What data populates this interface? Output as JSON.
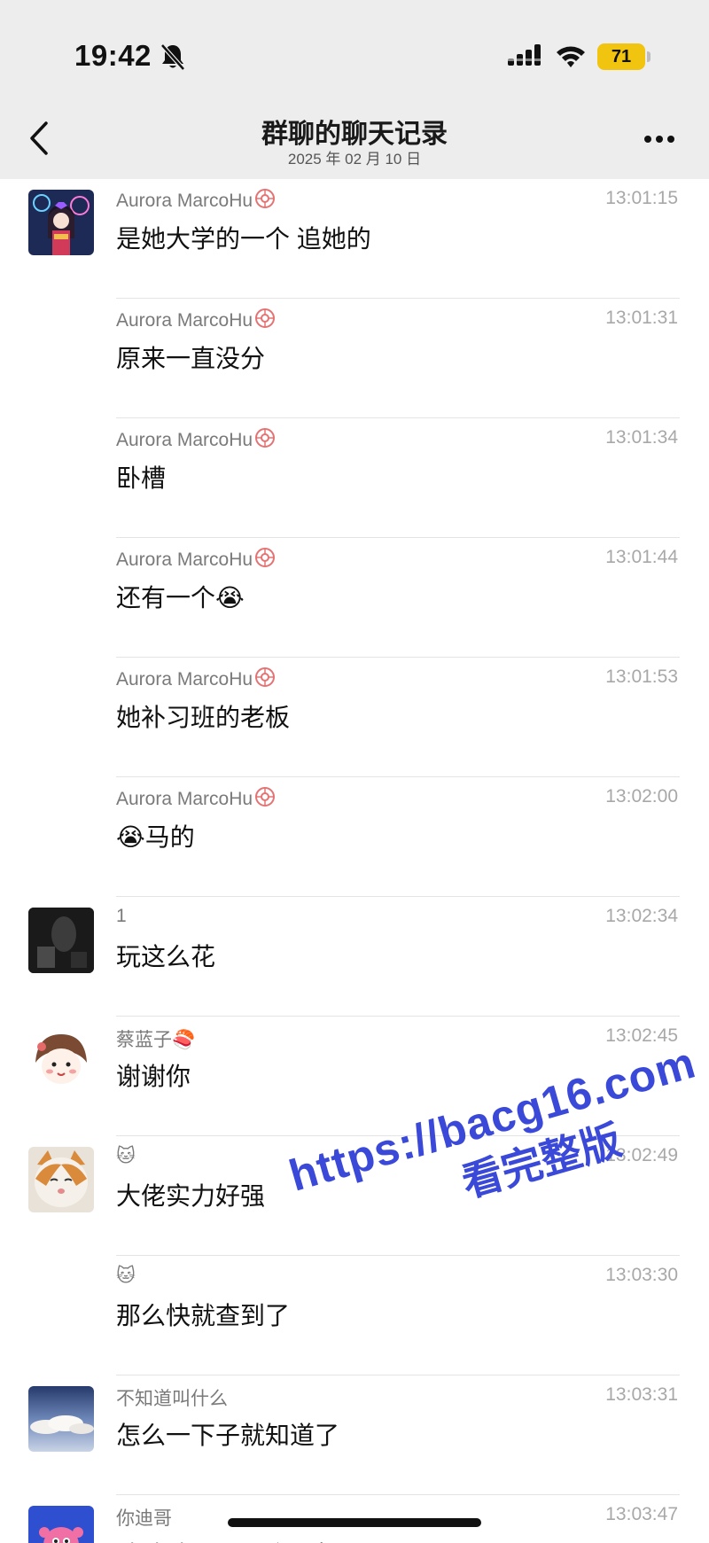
{
  "status_bar": {
    "time": "19:42",
    "battery_level": "71",
    "icons": [
      "bell-off-icon",
      "signal-icon",
      "wifi-icon",
      "battery-icon"
    ]
  },
  "header": {
    "title": "群聊的聊天记录",
    "subtitle": "2025 年 02 月 10 日",
    "back_icon": "chevron-left-icon",
    "more_icon": "more-horizontal-icon"
  },
  "messages": [
    {
      "sender": "Aurora MarcoHu",
      "time": "13:01:15",
      "text": "是她大学的一个 追她的",
      "avatar": "anime-girl"
    },
    {
      "sender": "Aurora MarcoHu",
      "time": "13:01:31",
      "text": "原来一直没分"
    },
    {
      "sender": "Aurora MarcoHu",
      "time": "13:01:34",
      "text": "卧槽"
    },
    {
      "sender": "Aurora MarcoHu",
      "time": "13:01:44",
      "text": "还有一个😭"
    },
    {
      "sender": "Aurora MarcoHu",
      "time": "13:01:53",
      "text": "她补习班的老板"
    },
    {
      "sender": "Aurora MarcoHu",
      "time": "13:02:00",
      "text": "😭马的"
    },
    {
      "sender": "1",
      "time": "13:02:34",
      "text": "玩这么花",
      "avatar": "dark-photo"
    },
    {
      "sender": "蔡蓝子🍣",
      "time": "13:02:45",
      "text": "谢谢你",
      "avatar": "cartoon-girl"
    },
    {
      "sender": "🐱",
      "time": "13:02:49",
      "text": "大佬实力好强",
      "avatar": "cat"
    },
    {
      "sender": "🐱",
      "time": "13:03:30",
      "text": "那么快就查到了"
    },
    {
      "sender": "不知道叫什么",
      "time": "13:03:31",
      "text": "怎么一下子就知道了",
      "avatar": "sky"
    },
    {
      "sender": "你迪哥",
      "time": "13:03:47",
      "text": "哈哈哈？一下个一起？",
      "avatar": "pink-creature"
    }
  ],
  "watermark": {
    "line1": "https://bacg16.com",
    "line2": "看完整版"
  },
  "colors": {
    "header_bg": "#ededed",
    "battery": "#f1c40f",
    "watermark": "#3a49d8"
  }
}
